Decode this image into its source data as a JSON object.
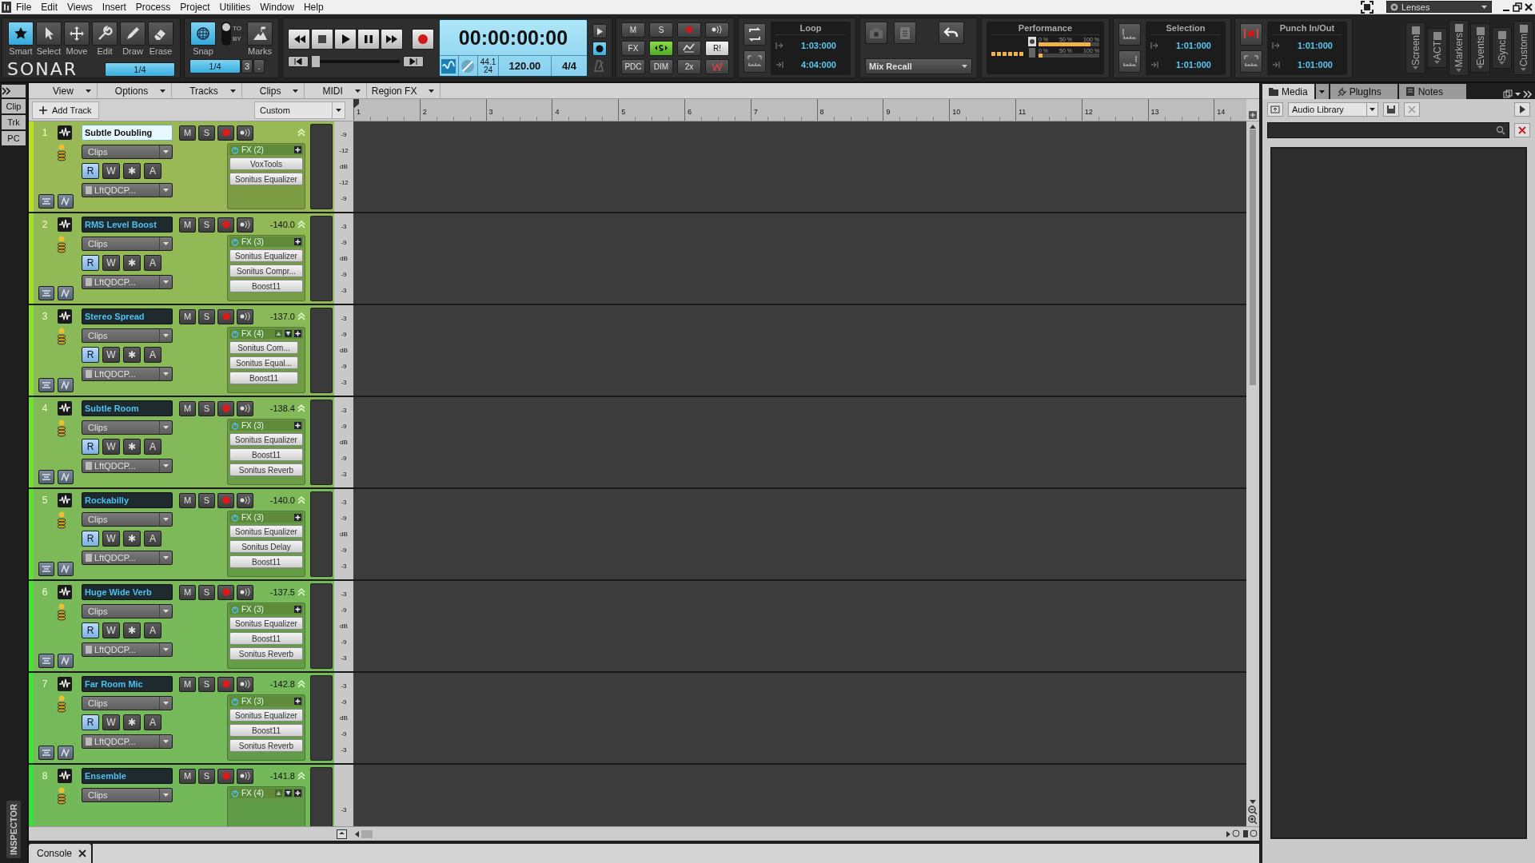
{
  "menu": [
    "File",
    "Edit",
    "Views",
    "Insert",
    "Process",
    "Project",
    "Utilities",
    "Window",
    "Help"
  ],
  "lenses": "Lenses",
  "tools": [
    {
      "kind": "smart",
      "label": "Smart",
      "selected": true
    },
    {
      "kind": "select",
      "label": "Select",
      "selected": false
    },
    {
      "kind": "move",
      "label": "Move",
      "selected": false
    },
    {
      "kind": "edit",
      "label": "Edit",
      "selected": false
    },
    {
      "kind": "draw",
      "label": "Draw",
      "selected": false
    },
    {
      "kind": "erase",
      "label": "Erase",
      "selected": false
    }
  ],
  "logo": "SONAR",
  "tool_resolution": "1/4",
  "snap": {
    "label": "Snap",
    "on": true,
    "to": "TO",
    "by": "BY",
    "marks": "Marks",
    "resolution": "1/4",
    "triplet": "3",
    "dot": "."
  },
  "scrub": {
    "level": 0
  },
  "time": "00:00:00:00",
  "sample_rate": "44.1",
  "bit_depth": "24",
  "tempo": "120.00",
  "meter": "4/4",
  "mix_buttons": [
    {
      "kind": "text",
      "label": "M",
      "on": false
    },
    {
      "kind": "text",
      "label": "S",
      "on": false
    },
    {
      "kind": "record",
      "on": false
    },
    {
      "kind": "preview",
      "on": false
    },
    {
      "kind": "text",
      "label": "FX",
      "on": false
    },
    {
      "kind": "swap",
      "on": true
    },
    {
      "kind": "automation",
      "on": false
    },
    {
      "kind": "text",
      "label": "R!",
      "on": true
    },
    {
      "kind": "text",
      "label": "PDC",
      "on": false
    },
    {
      "kind": "text",
      "label": "DIM",
      "on": false
    },
    {
      "kind": "text",
      "label": "2x",
      "on": false
    },
    {
      "kind": "write",
      "on": false
    }
  ],
  "loop": {
    "title": "Loop",
    "start": "1:03:000",
    "end": "4:04:000"
  },
  "mix_recall": "Mix Recall",
  "performance": {
    "title": "Performance",
    "meters": [
      {
        "scale": [
          "0 %",
          "50 %",
          "100 %"
        ],
        "level": 0.85
      },
      {
        "scale": [
          "0 %",
          "50 %",
          "100 %"
        ],
        "level": 0.06
      }
    ]
  },
  "selection": {
    "title": "Selection",
    "start": "1:01:000",
    "end": "1:01:000"
  },
  "punch": {
    "title": "Punch In/Out",
    "start": "1:01:000",
    "end": "1:01:000"
  },
  "side_modules": [
    "Screen",
    "ACT",
    "Markers",
    "Events",
    "Sync",
    "Custom"
  ],
  "inspector_tabs": [
    {
      "label": "Clip",
      "selected": false
    },
    {
      "label": "Trk",
      "selected": false
    },
    {
      "label": "PC",
      "selected": false
    }
  ],
  "inspector_label": "INSPECTOR",
  "track_menus": [
    "View",
    "Options",
    "Tracks",
    "Clips",
    "MIDI",
    "Region FX"
  ],
  "add_track": "Add Track",
  "preset": "Custom",
  "ruler": [
    "1",
    "2",
    "3",
    "4",
    "5",
    "6",
    "7",
    "8",
    "9",
    "10",
    "11",
    "12",
    "13",
    "14"
  ],
  "tracks": [
    {
      "number": "1",
      "name": "Subtle Doubling",
      "buttons": [
        "M",
        "S"
      ],
      "selected": true,
      "color": "#b8e02a",
      "clips": "Clips",
      "automation": [
        {
          "label": "R",
          "on": true
        },
        {
          "label": "W",
          "on": false
        },
        {
          "label": "✱",
          "on": false
        },
        {
          "label": "A",
          "on": false
        }
      ],
      "input": "LftQDCP...",
      "fx": "FX (2)",
      "fx_scroll": false,
      "plugins": [
        "VoxTools",
        "Sonitus Equalizer"
      ],
      "scale": [
        "-9",
        "-12",
        "dB",
        "-12",
        "-9"
      ]
    },
    {
      "number": "2",
      "name": "RMS Level Boost",
      "buttons": [
        "M",
        "S"
      ],
      "selected": false,
      "color": "#a0e02c",
      "volume": "-140.0",
      "clips": "Clips",
      "automation": [
        {
          "label": "R",
          "on": true
        },
        {
          "label": "W",
          "on": false
        },
        {
          "label": "✱",
          "on": false
        },
        {
          "label": "A",
          "on": false
        }
      ],
      "input": "LftQDCP...",
      "fx": "FX (3)",
      "fx_scroll": false,
      "plugins": [
        "Sonitus Equalizer",
        "Sonitus Compr...",
        "Boost11"
      ],
      "scale": [
        "-3",
        "-9",
        "dB",
        "-9",
        "-3"
      ]
    },
    {
      "number": "3",
      "name": "Stereo Spread",
      "buttons": [
        "M",
        "S"
      ],
      "selected": false,
      "color": "#8ae030",
      "volume": "-137.0",
      "clips": "Clips",
      "automation": [
        {
          "label": "R",
          "on": true
        },
        {
          "label": "W",
          "on": false
        },
        {
          "label": "✱",
          "on": false
        },
        {
          "label": "A",
          "on": false
        }
      ],
      "input": "LftQDCP...",
      "fx": "FX (4)",
      "fx_scroll": true,
      "plugins": [
        "Sonitus Com...",
        "Sonitus Equal...",
        "Boost11"
      ],
      "scale": [
        "-3",
        "-9",
        "dB",
        "-9",
        "-3"
      ]
    },
    {
      "number": "4",
      "name": "Subtle Room",
      "buttons": [
        "M",
        "S"
      ],
      "selected": false,
      "color": "#72e032",
      "volume": "-138.4",
      "clips": "Clips",
      "automation": [
        {
          "label": "R",
          "on": true
        },
        {
          "label": "W",
          "on": false
        },
        {
          "label": "✱",
          "on": false
        },
        {
          "label": "A",
          "on": false
        }
      ],
      "input": "LftQDCP...",
      "fx": "FX (3)",
      "fx_scroll": false,
      "plugins": [
        "Sonitus Equalizer",
        "Boost11",
        "Sonitus Reverb"
      ],
      "scale": [
        "-3",
        "-9",
        "dB",
        "-9",
        "-3"
      ]
    },
    {
      "number": "5",
      "name": "Rockabilly",
      "buttons": [
        "M",
        "S"
      ],
      "selected": false,
      "color": "#5ee034",
      "volume": "-140.0",
      "clips": "Clips",
      "automation": [
        {
          "label": "R",
          "on": true
        },
        {
          "label": "W",
          "on": false
        },
        {
          "label": "✱",
          "on": false
        },
        {
          "label": "A",
          "on": false
        }
      ],
      "input": "LftQDCP...",
      "fx": "FX (3)",
      "fx_scroll": false,
      "plugins": [
        "Sonitus Equalizer",
        "Sonitus Delay",
        "Boost11"
      ],
      "scale": [
        "-3",
        "-9",
        "dB",
        "-9",
        "-3"
      ]
    },
    {
      "number": "6",
      "name": "Huge Wide Verb",
      "buttons": [
        "M",
        "S"
      ],
      "selected": false,
      "color": "#4ee036",
      "volume": "-137.5",
      "clips": "Clips",
      "automation": [
        {
          "label": "R",
          "on": true
        },
        {
          "label": "W",
          "on": false
        },
        {
          "label": "✱",
          "on": false
        },
        {
          "label": "A",
          "on": false
        }
      ],
      "input": "LftQDCP...",
      "fx": "FX (3)",
      "fx_scroll": false,
      "plugins": [
        "Sonitus Equalizer",
        "Boost11",
        "Sonitus Reverb"
      ],
      "scale": [
        "-3",
        "-9",
        "dB",
        "-9",
        "-3"
      ]
    },
    {
      "number": "7",
      "name": "Far Room Mic",
      "buttons": [
        "M",
        "S"
      ],
      "selected": false,
      "color": "#44e038",
      "volume": "-142.8",
      "clips": "Clips",
      "automation": [
        {
          "label": "R",
          "on": true
        },
        {
          "label": "W",
          "on": false
        },
        {
          "label": "✱",
          "on": false
        },
        {
          "label": "A",
          "on": false
        }
      ],
      "input": "LftQDCP...",
      "fx": "FX (3)",
      "fx_scroll": false,
      "plugins": [
        "Sonitus Equalizer",
        "Boost11",
        "Sonitus Reverb"
      ],
      "scale": [
        "-3",
        "-9",
        "dB",
        "-9",
        "-3"
      ]
    },
    {
      "number": "8",
      "name": "Ensemble",
      "buttons": [
        "M",
        "S"
      ],
      "selected": false,
      "color": "#3ce03a",
      "volume": "-141.8",
      "clips": "Clips",
      "fx": "FX (4)",
      "fx_scroll": true,
      "scale": [
        "-3"
      ]
    }
  ],
  "browser": {
    "tabs": [
      {
        "label": "Media",
        "selected": true
      },
      {
        "label": "PlugIns",
        "selected": false
      },
      {
        "label": "Notes",
        "selected": false
      }
    ],
    "library": "Audio Library"
  },
  "console": "Console"
}
